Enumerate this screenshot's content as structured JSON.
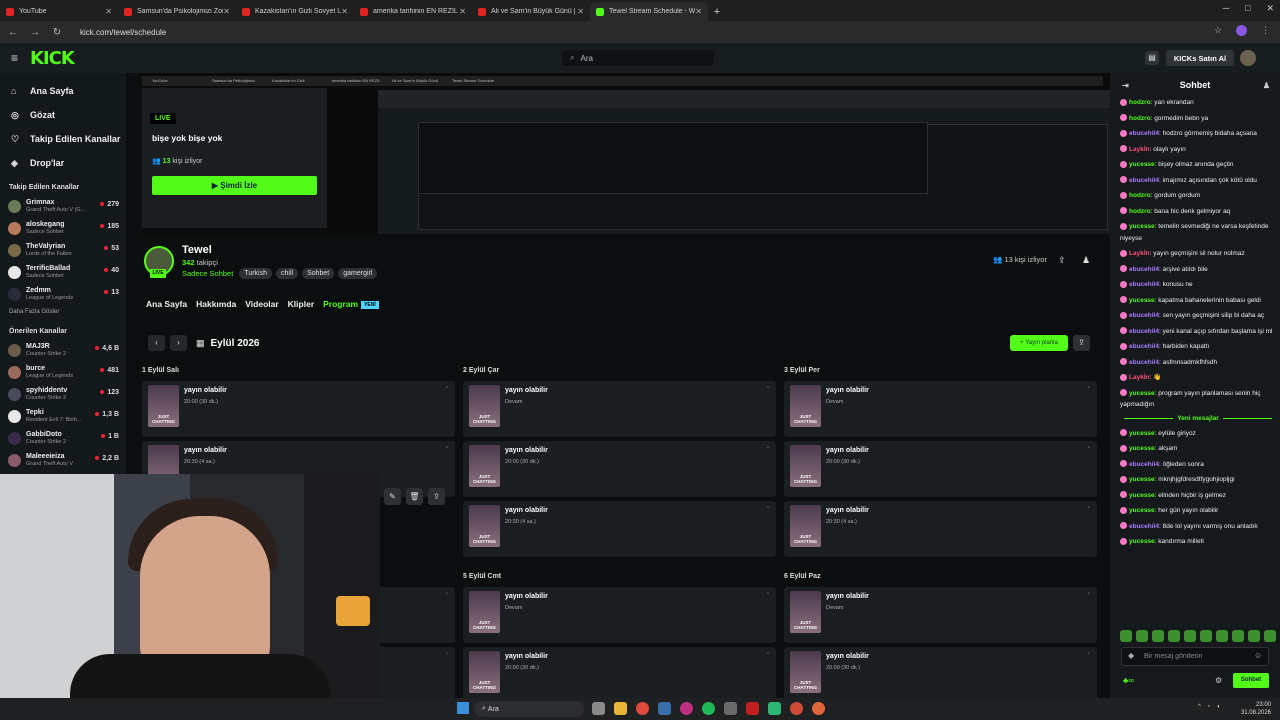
{
  "browser": {
    "tabs": [
      {
        "label": "YouTube",
        "kick": false
      },
      {
        "label": "Samsun'da Psikolojimizi Zorlaya",
        "kick": false
      },
      {
        "label": "Kazakistan'ın Gizli Sovyet Üsse",
        "kick": false
      },
      {
        "label": "amerika tarihinin EN REZİL",
        "kick": false
      },
      {
        "label": "Ali ve Sam'in Büyük Günü | Evli",
        "kick": false
      },
      {
        "label": "Tewel Stream Schedule - Watch",
        "kick": true
      }
    ],
    "url": "kick.com/tewel/schedule",
    "win_min": "─",
    "win_max": "□",
    "win_close": "✕"
  },
  "topnav": {
    "logo": "KICK",
    "search_placeholder": "Ara",
    "buy_button": "KICKs Satın Al"
  },
  "sidebar": {
    "main": [
      {
        "icon": "⌂",
        "label": "Ana Sayfa"
      },
      {
        "icon": "◎",
        "label": "Gözat"
      },
      {
        "icon": "♡",
        "label": "Takip Edilen Kanallar"
      },
      {
        "icon": "◈",
        "label": "Drop'lar"
      }
    ],
    "followed_header": "Takip Edilen Kanallar",
    "followed": [
      {
        "name": "Grimnax",
        "game": "Grand Theft Auto V (G...",
        "viewers": "279",
        "color": "#6a7b5a"
      },
      {
        "name": "aloskegang",
        "game": "Sadece Sohbet",
        "viewers": "185",
        "color": "#b9785a"
      },
      {
        "name": "TheValyrian",
        "game": "Lords of the Fallen",
        "viewers": "53",
        "color": "#7a6a4a"
      },
      {
        "name": "TerrificBallad",
        "game": "Sadece Sohbet",
        "viewers": "40",
        "color": "#e8e8e8"
      },
      {
        "name": "Zedmm",
        "game": "League of Legends",
        "viewers": "13",
        "color": "#2a2a3a"
      }
    ],
    "more_label": "Daha Fazla Göster",
    "suggested_header": "Önerilen Kanallar",
    "suggested": [
      {
        "name": "MAJ3R",
        "game": "Counter-Strike 2",
        "viewers": "4,6 B",
        "color": "#6a5a4a"
      },
      {
        "name": "burce",
        "game": "League of Legends",
        "viewers": "481",
        "color": "#9a6a5a"
      },
      {
        "name": "spyhiddentv",
        "game": "Counter-Strike 2",
        "viewers": "123",
        "color": "#4a4a5a"
      },
      {
        "name": "Tepki",
        "game": "Resident Evil 7: Bioh...",
        "viewers": "1,3 B",
        "color": "#e8e8e8"
      },
      {
        "name": "GabbiDoto",
        "game": "Counter-Strike 2",
        "viewers": "1 B",
        "color": "#3a2a4a"
      },
      {
        "name": "Maleeeieiza",
        "game": "Grand Theft Auto V",
        "viewers": "2,2 B",
        "color": "#8a5a6a"
      }
    ]
  },
  "player": {
    "live_badge": "LIVE",
    "stream_title": "bişe yok bişe yok",
    "viewers_count": "13",
    "viewers_suffix": "kişi izliyor",
    "watch_button": "Şimdi İzle",
    "mirror_tabs": [
      "YouTube",
      "Samsun'da Psikolojimizi",
      "Kazakistan'ın Gizli",
      "amerika tarihinin EN REZİL",
      "Ali ve Sam'in Büyük Günü",
      "Tewel Stream Schedule"
    ]
  },
  "channel": {
    "name": "Tewel",
    "followers": "342",
    "followers_suffix": "takipçi",
    "live_pill": "LIVE",
    "category": "Sadece Sohbet",
    "tags": [
      "Turkish",
      "chill",
      "Sohbet",
      "gamergirl"
    ],
    "viewers_label": "13 kişi izliyor"
  },
  "tabs": {
    "items": [
      "Ana Sayfa",
      "Hakkımda",
      "Videolar",
      "Klipler",
      "Program"
    ],
    "new_badge": "YENİ",
    "active_index": 4
  },
  "schedule": {
    "month": "Eylül 2026",
    "add_button": "+ Yayın planla",
    "days": [
      {
        "label": "1 Eylül Salı",
        "events": [
          {
            "title": "yayın olabilir",
            "time": "20:00 (30 dk.)"
          },
          {
            "title": "yayın olabilir",
            "time": "20:30 (4 sa.)"
          }
        ]
      },
      {
        "label": "2 Eylül Çar",
        "events": [
          {
            "title": "yayın olabilir",
            "time": "Devam"
          },
          {
            "title": "yayın olabilir",
            "time": "20:00 (30 dk.)"
          },
          {
            "title": "yayın olabilir",
            "time": "20:30 (4 sa.)"
          }
        ]
      },
      {
        "label": "3 Eylül Per",
        "events": [
          {
            "title": "yayın olabilir",
            "time": "Devam"
          },
          {
            "title": "yayın olabilir",
            "time": "20:00 (30 dk.)"
          },
          {
            "title": "yayın olabilir",
            "time": "20:30 (4 sa.)"
          }
        ]
      },
      {
        "label": "5 Eylül Cmt",
        "events": [
          {
            "title": "yayın olabilir",
            "time": "Devam"
          },
          {
            "title": "yayın olabilir",
            "time": "20:00 (30 dk.)"
          }
        ]
      },
      {
        "label": "6 Eylül Paz",
        "events": [
          {
            "title": "yayın olabilir",
            "time": "Devam"
          },
          {
            "title": "yayın olabilir",
            "time": "20:00 (30 dk.)"
          }
        ]
      },
      {
        "label": "",
        "events": [
          {
            "title": "yayın olabilir",
            "time": ""
          },
          {
            "title": "yayın olabilir",
            "time": ""
          }
        ]
      }
    ],
    "thumb_text": "JUST CHATTING"
  },
  "chat": {
    "title": "Sohbet",
    "new_messages_label": "Yeni mesajlar",
    "input_placeholder": "Bir mesaj gönderin",
    "send_button": "Sohbet",
    "messages_before": [
      {
        "user": "hodzro",
        "text": "yan ekrandan",
        "color": "#53fc18"
      },
      {
        "user": "hodzro",
        "text": "gormedim bebn ya",
        "color": "#53fc18"
      },
      {
        "user": "ebucehil4",
        "text": "hodzro görmemiş bidaha açsana",
        "color": "#a97cff"
      },
      {
        "user": "Laykİn",
        "text": "olaylı yayın",
        "color": "#ff4d7a"
      },
      {
        "user": "yucesse",
        "text": "bişey olmaz anında geçtin",
        "color": "#53fc18"
      },
      {
        "user": "ebucehil4",
        "text": "imajımız açısından çok kötü oldu",
        "color": "#a97cff"
      },
      {
        "user": "hodzro",
        "text": "gordum gordum",
        "color": "#53fc18"
      },
      {
        "user": "hodzro",
        "text": "bana hic denk gelmiyor aq",
        "color": "#53fc18"
      },
      {
        "user": "yucesse",
        "text": "temelin sevmediği ne varsa keşfetinde niyeyse",
        "color": "#53fc18"
      },
      {
        "user": "Laykİn",
        "text": "yayın geçmişini sil nolur nolmaz",
        "color": "#ff4d7a"
      },
      {
        "user": "ebucehil4",
        "text": "arşive atıldı bile",
        "color": "#a97cff"
      },
      {
        "user": "ebucehil4",
        "text": "konusu ne",
        "color": "#a97cff"
      },
      {
        "user": "yucesse",
        "text": "kapatma bahanelerinin babası geldi",
        "color": "#53fc18"
      },
      {
        "user": "ebucehil4",
        "text": "sen yayın geçmişini silip bi daha aç",
        "color": "#a97cff"
      },
      {
        "user": "ebucehil4",
        "text": "yeni kanal açıp sıfırdan başlama işi ml",
        "color": "#a97cff"
      },
      {
        "user": "ebucehil4",
        "text": "harbiden kapattı",
        "color": "#a97cff"
      },
      {
        "user": "ebucehil4",
        "text": "asfmnsadmkfhfsdh",
        "color": "#a97cff"
      },
      {
        "user": "Laykİn",
        "text": "👋",
        "color": "#ff4d7a"
      },
      {
        "user": "yucesse",
        "text": "program yayın planlaması senin hiç yapmadığın",
        "color": "#53fc18"
      }
    ],
    "messages_after": [
      {
        "user": "yucesse",
        "text": "eylüle giriyoz",
        "color": "#53fc18"
      },
      {
        "user": "yucesse",
        "text": "akşam",
        "color": "#53fc18"
      },
      {
        "user": "ebucehil4",
        "text": "öğleden sonra",
        "color": "#a97cff"
      },
      {
        "user": "yucesse",
        "text": "mknjhjgfdresdtfyguhjiopljgi",
        "color": "#53fc18"
      },
      {
        "user": "yucesse",
        "text": "elinden hiçbir iş gelmez",
        "color": "#53fc18"
      },
      {
        "user": "yucesse",
        "text": "her gün yayın olabilir",
        "color": "#53fc18"
      },
      {
        "user": "ebucehil4",
        "text": "8de lol yayını varmış onu anladık",
        "color": "#a97cff"
      },
      {
        "user": "yucesse",
        "text": "kandırma milleti",
        "color": "#53fc18"
      }
    ]
  },
  "taskbar": {
    "search": "Ara",
    "time": "23:00",
    "date": "31.08.2026"
  }
}
